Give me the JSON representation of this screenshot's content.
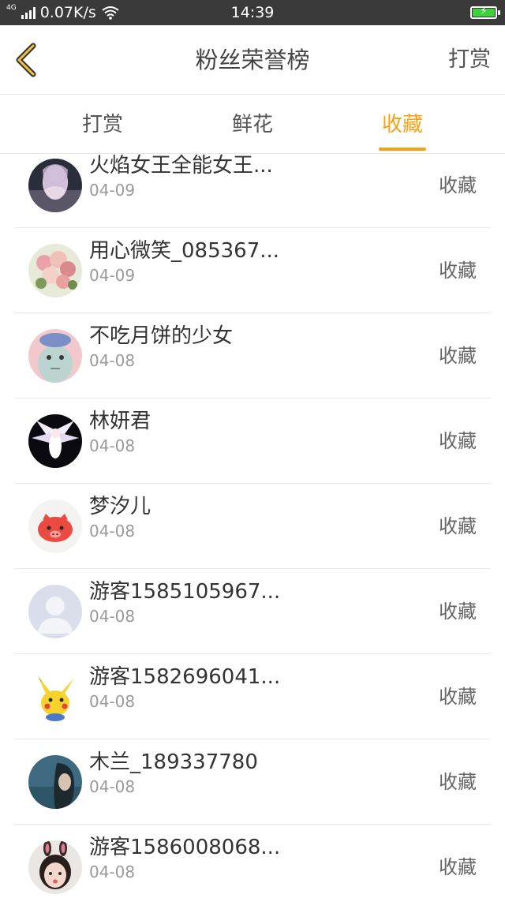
{
  "status_bar": {
    "network": "4G",
    "speed": "0.07K/s",
    "time": "14:39"
  },
  "header": {
    "title": "粉丝荣誉榜",
    "action": "打赏"
  },
  "tabs": [
    {
      "label": "打赏",
      "active": false
    },
    {
      "label": "鲜花",
      "active": false
    },
    {
      "label": "收藏",
      "active": true
    }
  ],
  "colors": {
    "accent": "#f5a114",
    "status_bar_bg": "#3a3a3a",
    "battery": "#3ecf3e"
  },
  "list": [
    {
      "name": "火焰女王全能女王...",
      "date": "04-09",
      "action": "收藏",
      "avatar": "anime-girl-avatar"
    },
    {
      "name": "用心微笑_085367...",
      "date": "04-09",
      "action": "收藏",
      "avatar": "flowers-avatar"
    },
    {
      "name": "不吃月饼的少女",
      "date": "04-08",
      "action": "收藏",
      "avatar": "cartoon-character-avatar"
    },
    {
      "name": "林妍君",
      "date": "04-08",
      "action": "收藏",
      "avatar": "white-fox-avatar"
    },
    {
      "name": "梦汐儿",
      "date": "04-08",
      "action": "收藏",
      "avatar": "red-pig-avatar"
    },
    {
      "name": "游客1585105967...",
      "date": "04-08",
      "action": "收藏",
      "avatar": "default-user-avatar"
    },
    {
      "name": "游客1582696041...",
      "date": "04-08",
      "action": "收藏",
      "avatar": "pikachu-avatar"
    },
    {
      "name": "木兰_189337780",
      "date": "04-08",
      "action": "收藏",
      "avatar": "portrait-photo-avatar"
    },
    {
      "name": "游客1586008068...",
      "date": "04-08",
      "action": "收藏",
      "avatar": "girl-bunny-ears-avatar"
    }
  ]
}
